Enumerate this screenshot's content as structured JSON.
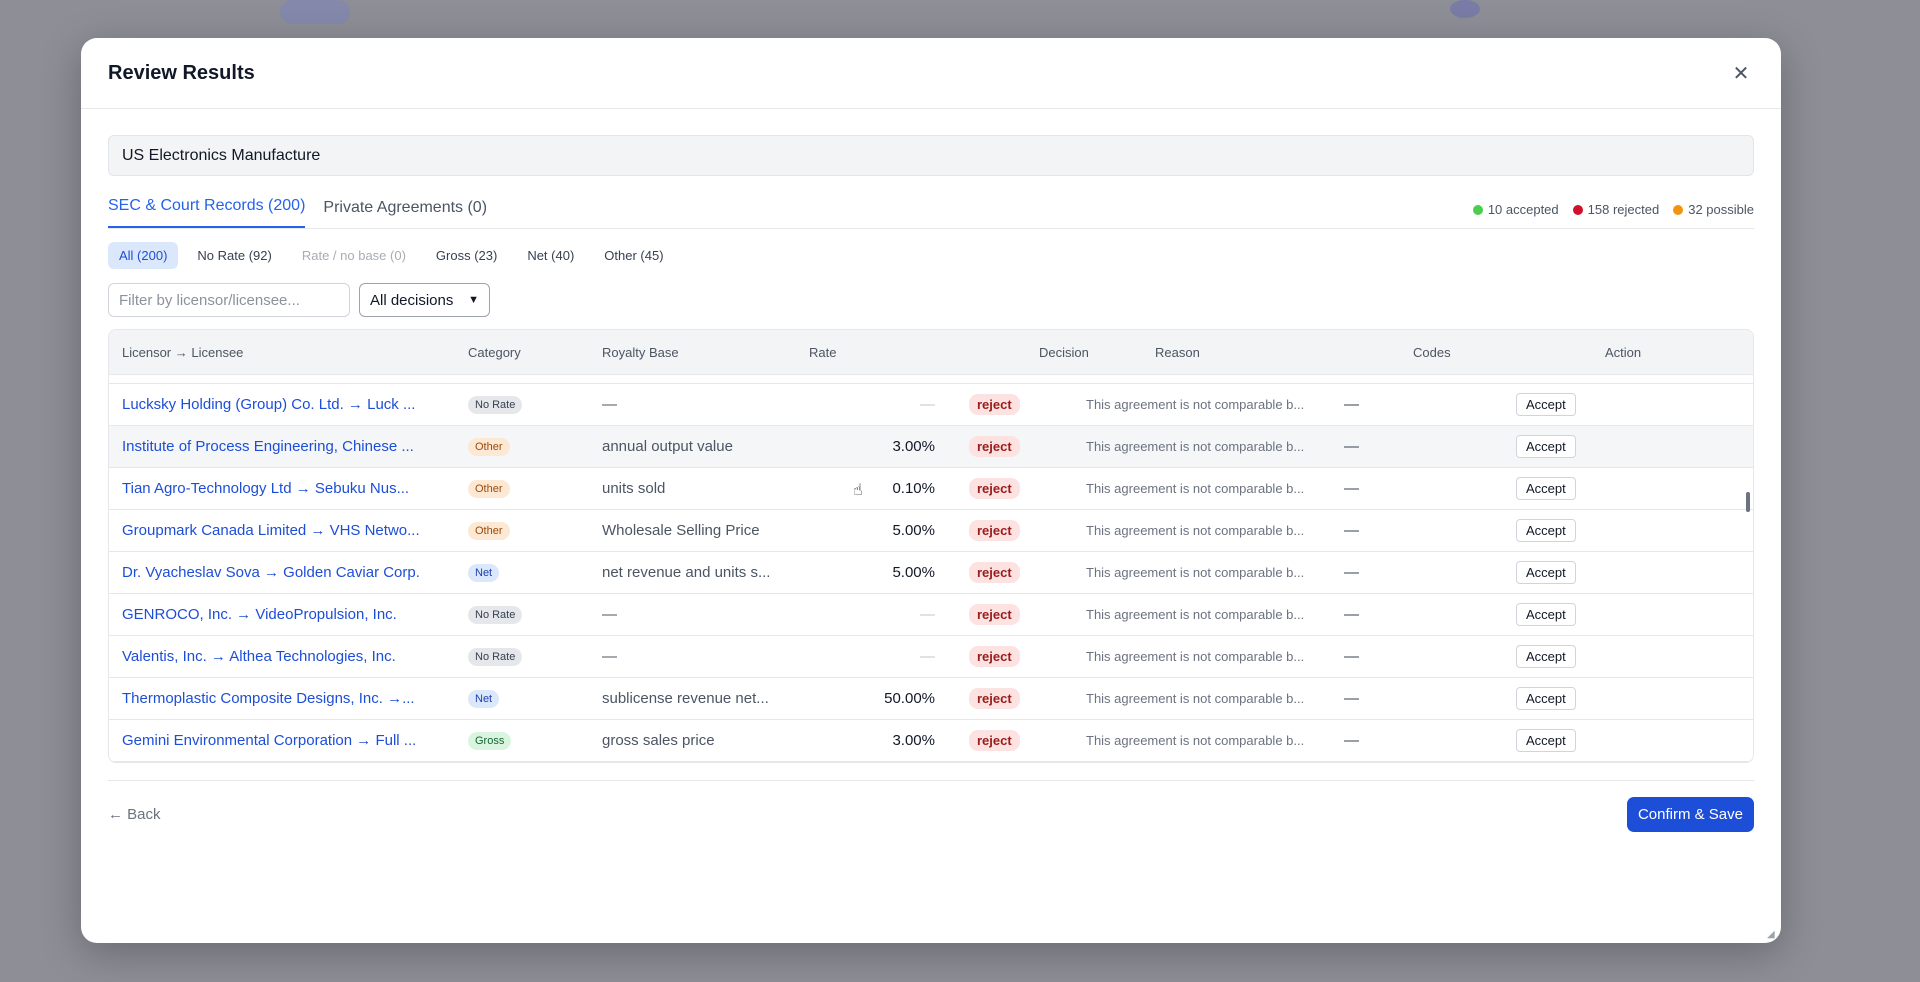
{
  "modal": {
    "title": "Review Results",
    "close_icon": "close-icon"
  },
  "company": "US Electronics Manufacture",
  "tabs": [
    {
      "label": "SEC & Court Records (200)",
      "active": true
    },
    {
      "label": "Private Agreements (0)",
      "active": false
    }
  ],
  "stats": [
    {
      "label": "10 accepted",
      "color": "#4ccd4c"
    },
    {
      "label": "158 rejected",
      "color": "#d0102c"
    },
    {
      "label": "32 possible",
      "color": "#f2940f"
    }
  ],
  "chips": [
    {
      "label": "All (200)",
      "state": "active"
    },
    {
      "label": "No Rate (92)",
      "state": "normal"
    },
    {
      "label": "Rate / no base (0)",
      "state": "disabled"
    },
    {
      "label": "Gross (23)",
      "state": "normal"
    },
    {
      "label": "Net (40)",
      "state": "normal"
    },
    {
      "label": "Other (45)",
      "state": "normal"
    }
  ],
  "filter": {
    "placeholder": "Filter by licensor/licensee...",
    "decision_select": "All decisions"
  },
  "table": {
    "headers": {
      "licensor": "Licensor → Licensee",
      "category": "Category",
      "base": "Royalty Base",
      "rate": "Rate",
      "decision": "Decision",
      "reason": "Reason",
      "codes": "Codes",
      "action": "Action"
    },
    "rows": [
      {
        "licensor": "Lucksky Holding (Group) Co. Ltd. → Luck ...",
        "category": "No Rate",
        "cat": "norate",
        "base": "—",
        "rate": "—",
        "decision": "reject",
        "reason": "This agreement is not comparable b...",
        "codes": "—",
        "action": "Accept"
      },
      {
        "licensor": "Institute of Process Engineering, Chinese ...",
        "category": "Other",
        "cat": "other",
        "base": "annual output value",
        "rate": "3.00%",
        "decision": "reject",
        "reason": "This agreement is not comparable b...",
        "codes": "—",
        "action": "Accept"
      },
      {
        "licensor": "Tian Agro-Technology Ltd → Sebuku Nus...",
        "category": "Other",
        "cat": "other",
        "base": "units sold",
        "rate": "0.10%",
        "decision": "reject",
        "reason": "This agreement is not comparable b...",
        "codes": "—",
        "action": "Accept"
      },
      {
        "licensor": "Groupmark Canada Limited → VHS Netwo...",
        "category": "Other",
        "cat": "other",
        "base": "Wholesale Selling Price",
        "rate": "5.00%",
        "decision": "reject",
        "reason": "This agreement is not comparable b...",
        "codes": "—",
        "action": "Accept"
      },
      {
        "licensor": "Dr. Vyacheslav Sova → Golden Caviar Corp.",
        "category": "Net",
        "cat": "net",
        "base": "net revenue and units s...",
        "rate": "5.00%",
        "decision": "reject",
        "reason": "This agreement is not comparable b...",
        "codes": "—",
        "action": "Accept"
      },
      {
        "licensor": "GENROCO, Inc. → VideoPropulsion, Inc.",
        "category": "No Rate",
        "cat": "norate",
        "base": "—",
        "rate": "—",
        "decision": "reject",
        "reason": "This agreement is not comparable b...",
        "codes": "—",
        "action": "Accept"
      },
      {
        "licensor": "Valentis, Inc. → Althea Technologies, Inc.",
        "category": "No Rate",
        "cat": "norate",
        "base": "—",
        "rate": "—",
        "decision": "reject",
        "reason": "This agreement is not comparable b...",
        "codes": "—",
        "action": "Accept"
      },
      {
        "licensor": "Thermoplastic Composite Designs, Inc. →...",
        "category": "Net",
        "cat": "net",
        "base": "sublicense revenue net...",
        "rate": "50.00%",
        "decision": "reject",
        "reason": "This agreement is not comparable b...",
        "codes": "—",
        "action": "Accept"
      },
      {
        "licensor": "Gemini Environmental Corporation → Full ...",
        "category": "Gross",
        "cat": "gross",
        "base": "gross sales price",
        "rate": "3.00%",
        "decision": "reject",
        "reason": "This agreement is not comparable b...",
        "codes": "—",
        "action": "Accept"
      }
    ]
  },
  "footer": {
    "back": "← Back",
    "confirm": "Confirm & Save"
  }
}
